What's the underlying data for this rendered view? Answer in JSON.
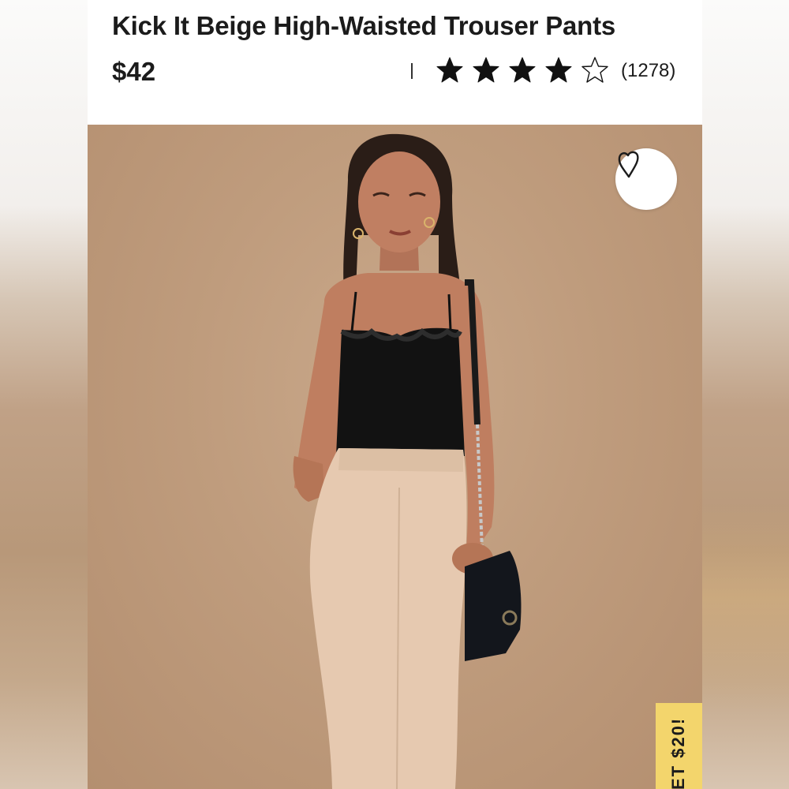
{
  "product": {
    "title": "Kick It Beige High-Waisted Trouser Pants",
    "price": "$42",
    "rating": 4,
    "rating_max": 5,
    "review_count": "(1278)"
  },
  "photo": {
    "favorite_icon": "heart-icon"
  },
  "promo": {
    "label": "ET $20!"
  },
  "colors": {
    "background_beige": "#c0a084",
    "pants_beige": "#e6c9b0",
    "promo_yellow": "#f3d56c",
    "text": "#1b1b1b"
  }
}
